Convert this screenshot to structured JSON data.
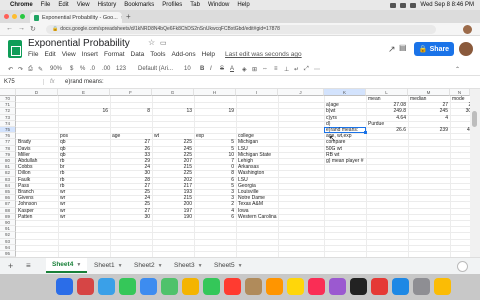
{
  "menubar": {
    "apple": "",
    "items": [
      "Chrome",
      "File",
      "Edit",
      "View",
      "History",
      "Bookmarks",
      "Profiles",
      "Tab",
      "Window",
      "Help"
    ],
    "datetime": "Wed Sep 8 8:46 PM"
  },
  "browser": {
    "tab_title": "Exponential Probability - Goo...",
    "tab_close": "×",
    "new_tab": "+",
    "url": "docs.google.com/spreadsheets/d/1kNRD8N4bQe6Fk8ChDS2nSnUkwcqFCBxtGbd/edit#gid=17878",
    "colors": {
      "close": "#ff5f57",
      "minimize": "#febc2e",
      "maximize": "#28c840"
    }
  },
  "sheets": {
    "title": "Exponential Probability",
    "menu": [
      "File",
      "Edit",
      "View",
      "Insert",
      "Format",
      "Data",
      "Tools",
      "Add-ons",
      "Help"
    ],
    "last_edit": "Last edit was seconds ago",
    "share_label": "Share",
    "brand_color": "#0f9d58",
    "share_color": "#1a73e8"
  },
  "toolbar": {
    "zoom": "90%",
    "currency": "$",
    "percent": "%",
    "decimals_down": ".0",
    "decimals_up": ".00",
    "format": "123",
    "font": "Default (Ari...",
    "font_size": "10",
    "bold": "B",
    "italic": "I",
    "strike": "S",
    "text_color": "A"
  },
  "formula_bar": {
    "cell_ref": "K75",
    "fx": "fx",
    "content": "e)rand means:"
  },
  "grid": {
    "columns": [
      {
        "label": "D"
      },
      {
        "label": "E"
      },
      {
        "label": "F"
      },
      {
        "label": "G"
      },
      {
        "label": "H"
      },
      {
        "label": "I"
      },
      {
        "label": "J"
      },
      {
        "label": "K"
      },
      {
        "label": "L"
      },
      {
        "label": "M"
      },
      {
        "label": "N"
      }
    ],
    "row_numbers": [
      "70",
      "71",
      "72",
      "73",
      "74",
      "75",
      "76",
      "77",
      "78",
      "79",
      "80",
      "81",
      "82",
      "83",
      "84",
      "85",
      "86",
      "87",
      "88",
      "89",
      "90",
      "91",
      "92",
      "93",
      "94",
      "95"
    ],
    "left_table": {
      "row72": [
        "16",
        "8",
        "13",
        "19"
      ],
      "headers": [
        "pos",
        "age",
        "wt",
        "exp",
        "college"
      ],
      "rows": [
        [
          "Brady",
          "qb",
          "27",
          "225",
          "5",
          "Michigan"
        ],
        [
          "Davis",
          "qb",
          "26",
          "245",
          "5",
          "LSU"
        ],
        [
          "Miller",
          "qb",
          "33",
          "225",
          "10",
          "Michigan State"
        ],
        [
          "Abdullah",
          "rb",
          "29",
          "207",
          "7",
          "Lehigh"
        ],
        [
          "Cobbs",
          "br",
          "24",
          "215",
          "0",
          "Arkansas"
        ],
        [
          "Dillon",
          "rb",
          "30",
          "225",
          "8",
          "Washington"
        ],
        [
          "Faulk",
          "rb",
          "28",
          "202",
          "6",
          "LSU"
        ],
        [
          "Pass",
          "rb",
          "27",
          "217",
          "5",
          "Georgia"
        ],
        [
          "Branch",
          "wr",
          "25",
          "193",
          "3",
          "Louisville"
        ],
        [
          "Givens",
          "wr",
          "24",
          "215",
          "3",
          "Notre Dame"
        ],
        [
          "Johnson",
          "wr",
          "25",
          "200",
          "2",
          "Texas A&M"
        ],
        [
          "Kasper",
          "wr",
          "27",
          "197",
          "4",
          "Iowa"
        ],
        [
          "Patten",
          "wr",
          "30",
          "190",
          "6",
          "Western Carolina"
        ]
      ]
    },
    "right_table": {
      "headers": [
        "mean",
        "median",
        "mode"
      ],
      "rows": [
        {
          "label": "a)age",
          "values": [
            "27.08",
            "27",
            "26"
          ]
        },
        {
          "label": "b)wt",
          "values": [
            "249.8",
            "245",
            "305"
          ]
        },
        {
          "label": "c)yrs",
          "values": [
            "4.64",
            "4",
            "3"
          ]
        },
        {
          "label": "d)",
          "values": [
            "Purdue",
            "",
            ""
          ]
        },
        {
          "label": "e)rand means:",
          "values": [
            "26.6",
            "239",
            "4.2"
          ]
        }
      ],
      "notes": [
        "age, wt,exp",
        "compare",
        "50G wt",
        "RB wt",
        "g) mean player #"
      ]
    },
    "active_color": "#1a73e8"
  },
  "sheet_tabs": {
    "add": "+",
    "list": "≡",
    "tabs": [
      "Sheet4",
      "Sheet1",
      "Sheet2",
      "Sheet3",
      "Sheet5"
    ],
    "active": "Sheet4",
    "active_color": "#188038"
  },
  "dock": {
    "apps": [
      "finder",
      "launchpad",
      "safari",
      "messages",
      "mail",
      "maps",
      "photos",
      "facetime",
      "calendar",
      "contacts",
      "reminders",
      "notes",
      "music",
      "podcasts",
      "tv",
      "news",
      "app-store",
      "settings",
      "chrome",
      "zoom",
      "word",
      "excel",
      "firefox",
      "trash"
    ]
  }
}
